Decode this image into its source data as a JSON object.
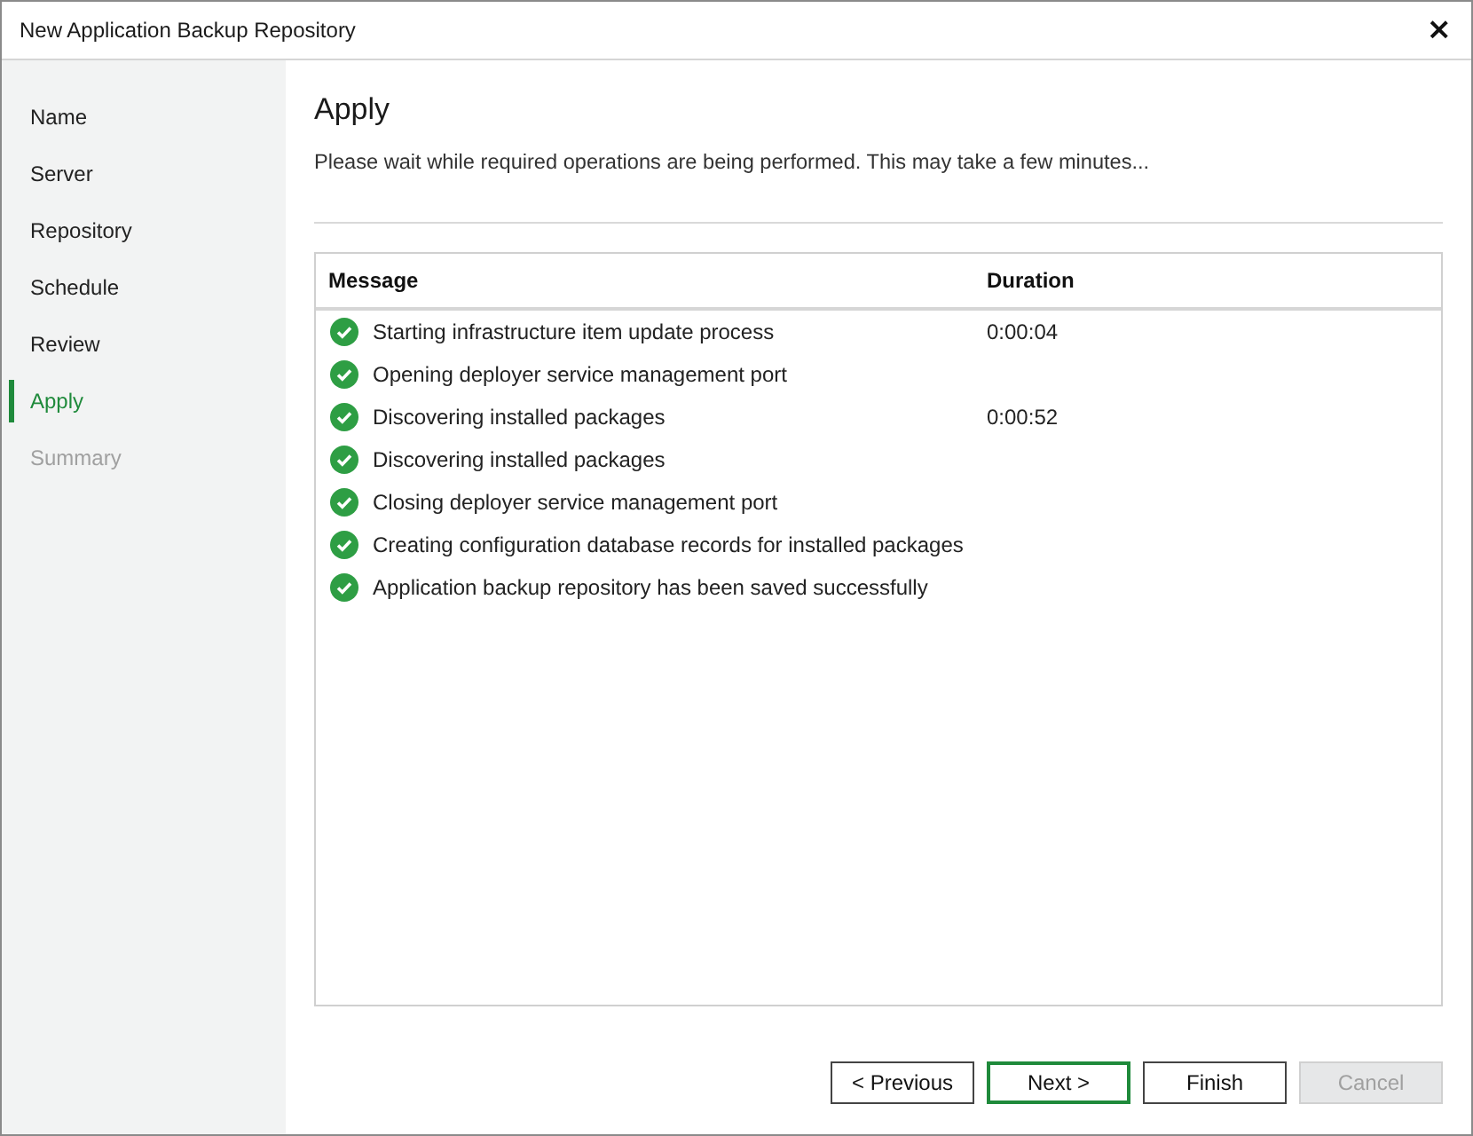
{
  "window": {
    "title": "New Application Backup Repository",
    "close": "×"
  },
  "steps": [
    {
      "label": "Name",
      "selected": false,
      "disabled": false
    },
    {
      "label": "Server",
      "selected": false,
      "disabled": false
    },
    {
      "label": "Repository",
      "selected": false,
      "disabled": false
    },
    {
      "label": "Schedule",
      "selected": false,
      "disabled": false
    },
    {
      "label": "Review",
      "selected": false,
      "disabled": false
    },
    {
      "label": "Apply",
      "selected": true,
      "disabled": false
    },
    {
      "label": "Summary",
      "selected": false,
      "disabled": true
    }
  ],
  "page": {
    "heading": "Apply",
    "description": "Please wait while required operations are being performed. This may take a few minutes..."
  },
  "table": {
    "columns": [
      "Message",
      "Duration"
    ],
    "rows": [
      {
        "succeeded": true,
        "message": "Starting infrastructure item update process",
        "duration": "0:00:04"
      },
      {
        "succeeded": true,
        "message": "Opening deployer service management port"
      },
      {
        "succeeded": true,
        "message": "Discovering installed packages",
        "duration": "0:00:52"
      },
      {
        "succeeded": true,
        "message": "Discovering installed packages"
      },
      {
        "succeeded": true,
        "message": "Closing deployer service management port"
      },
      {
        "succeeded": true,
        "message": "Creating configuration database records for installed packages"
      },
      {
        "succeeded": true,
        "message": "Application backup repository has been saved successfully"
      }
    ]
  },
  "buttons": [
    {
      "label": "< Previous",
      "default": false,
      "disabled": false
    },
    {
      "label": "Next >",
      "default": true,
      "disabled": false
    },
    {
      "label": "Finish",
      "default": false,
      "disabled": false
    },
    {
      "label": "Cancel",
      "default": false,
      "disabled": true
    }
  ]
}
